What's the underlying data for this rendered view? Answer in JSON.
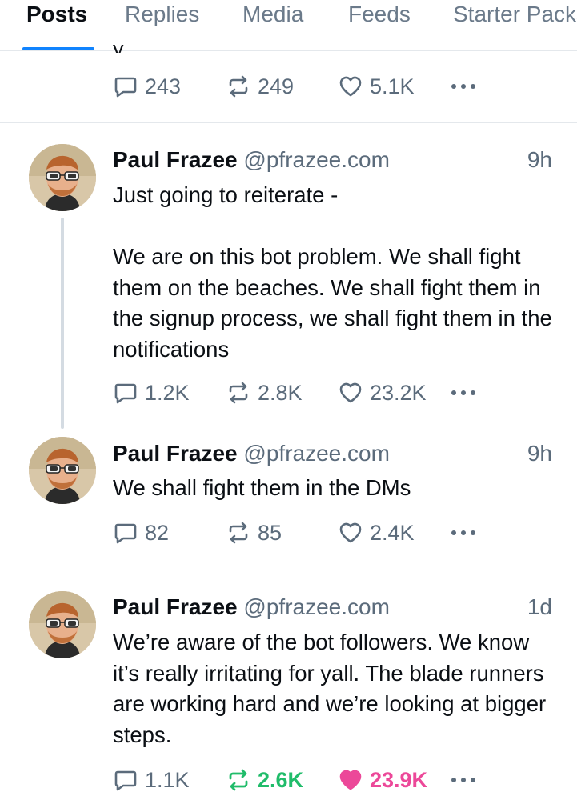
{
  "tabs": [
    {
      "label": "Posts",
      "active": true
    },
    {
      "label": "Replies"
    },
    {
      "label": "Media"
    },
    {
      "label": "Feeds"
    },
    {
      "label": "Starter Packs"
    }
  ],
  "top_partial": {
    "text": "y",
    "actions": {
      "replies": "243",
      "reposts": "249",
      "likes": "5.1K"
    }
  },
  "posts": [
    {
      "author_name": "Paul Frazee",
      "author_handle": "@pfrazee.com",
      "time": "9h",
      "text": "Just going to reiterate -\n\nWe are on this bot problem. We shall fight them on the beaches. We shall fight them in the signup process, we shall fight them in the notifications",
      "replies": "1.2K",
      "reposts": "2.8K",
      "likes": "23.2K"
    },
    {
      "author_name": "Paul Frazee",
      "author_handle": "@pfrazee.com",
      "time": "9h",
      "text": "We shall fight them in the DMs",
      "replies": "82",
      "reposts": "85",
      "likes": "2.4K"
    },
    {
      "author_name": "Paul Frazee",
      "author_handle": "@pfrazee.com",
      "time": "1d",
      "text": "We’re aware of the bot followers. We know it’s really irritating for yall. The blade runners are working hard and we’re looking at bigger steps.",
      "replies": "1.1K",
      "reposts": "2.6K",
      "likes": "23.9K",
      "reposted_by_viewer": true,
      "liked_by_viewer": true
    }
  ],
  "colors": {
    "accent": "#1083fe",
    "repost_active": "#20bc6a",
    "like_active": "#ec4899",
    "muted": "#5b6b7b"
  },
  "icons": [
    "reply-icon",
    "repost-icon",
    "like-icon",
    "more-icon"
  ]
}
